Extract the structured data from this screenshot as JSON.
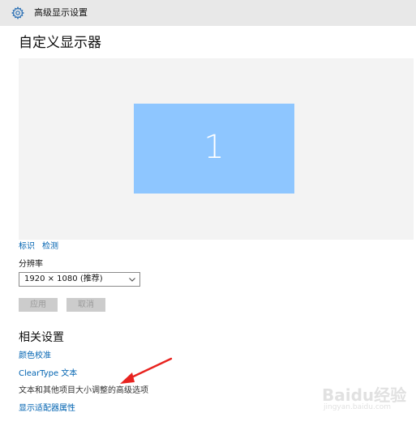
{
  "window": {
    "title": "高级显示设置",
    "icon": "gear-icon"
  },
  "page": {
    "title": "自定义显示器"
  },
  "display": {
    "number": "1",
    "monitor_color": "#8ec6ff",
    "canvas_color": "#f3f3f3"
  },
  "links": {
    "identify": "标识",
    "detect": "检测"
  },
  "resolution": {
    "label": "分辨率",
    "value": "1920 × 1080 (推荐)"
  },
  "buttons": {
    "apply": "应用",
    "cancel": "取消"
  },
  "related": {
    "title": "相关设置",
    "color_calibration": "颜色校准",
    "cleartype": "ClearType 文本",
    "text_sizing": "文本和其他项目大小调整的高级选项",
    "adapter_properties": "显示适配器属性"
  },
  "watermark": {
    "brand": "Baidu经验",
    "url": "jingyan.baidu.com"
  },
  "colors": {
    "link": "#0063b1",
    "annotation_arrow": "#e8231f"
  }
}
